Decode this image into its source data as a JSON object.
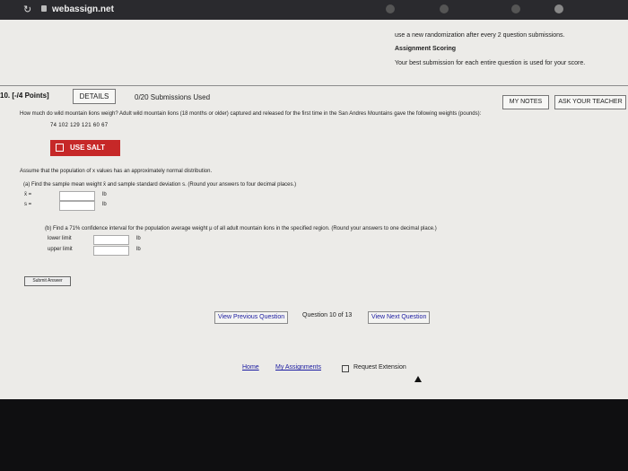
{
  "browser": {
    "url": "webassign.net",
    "reload_icon": "reload-icon"
  },
  "top_info": {
    "line1": "use a new randomization after every 2 question submissions.",
    "heading": "Assignment Scoring",
    "line2": "Your best submission for each entire question is used for your score."
  },
  "question_header": {
    "number": "10. [-/4 Points]",
    "details_label": "DETAILS",
    "submissions_used": "0/20 Submissions Used",
    "my_notes_label": "MY NOTES",
    "ask_teacher_label": "ASK YOUR TEACHER"
  },
  "question": {
    "text": "How much do wild mountain lions weigh? Adult wild mountain lions (18 months or older) captured and released for the first time in the San Andres Mountains gave the following weights (pounds):",
    "data": "74   102   129   121   60   67",
    "salt_label": "USE SALT",
    "assume": "Assume that the population of x values has an approximately normal distribution.",
    "part_a": "(a) Find the sample mean weight x̄ and sample standard deviation s. (Round your answers to four decimal places.)",
    "xbar_label": "x̄ =",
    "s_label": "s =",
    "unit": "lb",
    "part_b": "(b) Find a 71% confidence interval for the population average weight μ of all adult mountain lions in the specified region. (Round your answers to one decimal place.)",
    "lower_label": "lower limit",
    "upper_label": "upper limit",
    "submit_label": "Submit Answer"
  },
  "navigation": {
    "prev_label": "View Previous Question",
    "question_of": "Question 10 of 13",
    "next_label": "View Next Question"
  },
  "footer_links": {
    "home": "Home",
    "my_assignments": "My Assignments",
    "request_extension": "Request Extension"
  }
}
